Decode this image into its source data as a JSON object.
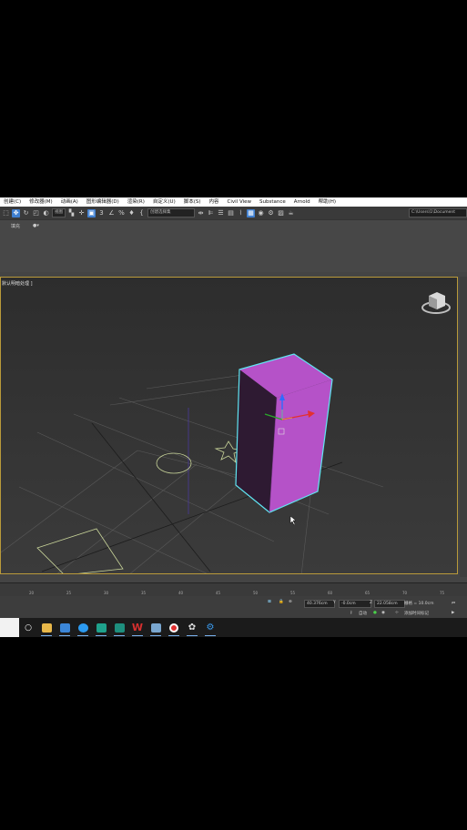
{
  "menubar": [
    "创建(C)",
    "修改器(M)",
    "动画(A)",
    "图形编辑器(D)",
    "渲染(R)",
    "自定义(U)",
    "脚本(S)",
    "内容",
    "Civil View",
    "Substance",
    "Arnold",
    "帮助(H)"
  ],
  "toolbar": {
    "view_dropdown": "视图",
    "selection_set_dropdown": "创建选择集",
    "path_field": "C:\\Users\\1\\Document"
  },
  "ribbon": {
    "label": "填充",
    "dots": "●▾"
  },
  "viewport": {
    "label": "默认明暗处理 ]"
  },
  "timeline": {
    "ticks": [
      "20",
      "25",
      "30",
      "35",
      "40",
      "45",
      "50",
      "55",
      "60",
      "65",
      "70",
      "75"
    ]
  },
  "statusbar": {
    "x": "40.376cm",
    "y_label": "Y",
    "y": "-0.0cm",
    "z_label": "Z",
    "z": "22.058cm",
    "grid": "栅格 = 10.0cm",
    "autokey": "自动",
    "add_time_tag": "添加时间标记"
  },
  "taskbar": {
    "apps": [
      {
        "name": "search",
        "color": "#ffffff"
      },
      {
        "name": "file-explorer",
        "color": "#e8b84a"
      },
      {
        "name": "mail",
        "color": "#3b86d8"
      },
      {
        "name": "browser",
        "color": "#2c9af0"
      },
      {
        "name": "3dsmax-green",
        "color": "#1fa28c"
      },
      {
        "name": "3dsmax",
        "color": "#1e8f7e"
      },
      {
        "name": "wps",
        "color": "#d8302f"
      },
      {
        "name": "tool",
        "color": "#7aa7d0"
      },
      {
        "name": "recorder",
        "color": "#e03030"
      },
      {
        "name": "settings",
        "color": "#dddddd"
      },
      {
        "name": "app",
        "color": "#3b9bef"
      }
    ]
  },
  "colors": {
    "box_fill": "#b552c8",
    "box_outline": "#5fe6f2",
    "viewport_border": "#b99a3a"
  }
}
